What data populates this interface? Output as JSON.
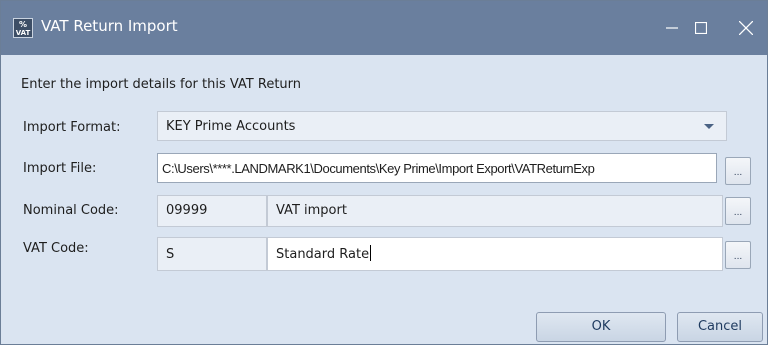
{
  "window": {
    "title": "VAT Return Import",
    "icon_text": "%",
    "icon_subtext": "VAT"
  },
  "dialog": {
    "intro": "Enter the import details for this VAT Return",
    "import_format": {
      "label": "Import Format:",
      "value": "KEY Prime Accounts"
    },
    "import_file": {
      "label": "Import File:",
      "value": "C:\\Users\\****.LANDMARK1\\Documents\\Key Prime\\Import Export\\VATReturnExp"
    },
    "nominal_code": {
      "label": "Nominal Code:",
      "code": "09999",
      "description": "VAT import"
    },
    "vat_code": {
      "label": "VAT Code:",
      "code": "S",
      "description": "Standard Rate"
    },
    "ellipsis": "...",
    "ok_label": "OK",
    "cancel_label": "Cancel"
  },
  "icons": [
    "app-vat-icon",
    "minimize-icon",
    "maximize-icon",
    "close-icon",
    "dropdown-arrow-icon"
  ],
  "colors": {
    "titlebar": "#6a7f9e",
    "dialog_background": "#dae4f1",
    "button_text": "#1e3a5f"
  }
}
